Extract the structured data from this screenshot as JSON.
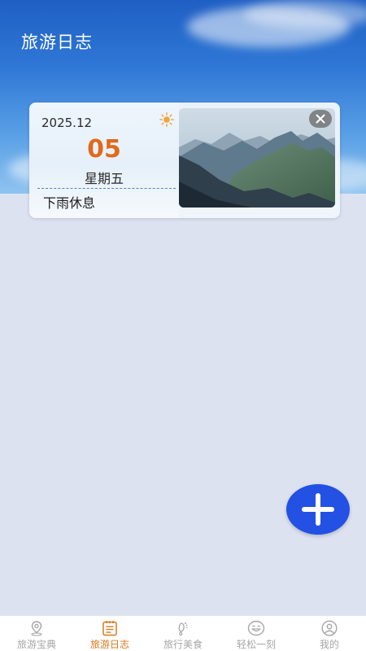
{
  "header": {
    "title": "旅游日志"
  },
  "journal_entries": [
    {
      "year_month": "2025.12",
      "day": "05",
      "weekday": "星期五",
      "note": "下雨休息",
      "weather_icon": "sun-icon",
      "photo_subject": "mountain-landscape"
    }
  ],
  "fab": {
    "icon": "plus-icon"
  },
  "tabbar": {
    "active_index": 1,
    "active_color": "#d9781f",
    "inactive_color": "#a6a6a6",
    "items": [
      {
        "label": "旅游宝典",
        "icon": "map-pin-icon"
      },
      {
        "label": "旅游日志",
        "icon": "notebook-icon"
      },
      {
        "label": "旅行美食",
        "icon": "footprint-icon"
      },
      {
        "label": "轻松一刻",
        "icon": "smile-icon"
      },
      {
        "label": "我的",
        "icon": "user-icon"
      }
    ]
  },
  "colors": {
    "background": "#dde2f1",
    "accent_day": "#e06a1a",
    "fab": "#2251e4"
  }
}
